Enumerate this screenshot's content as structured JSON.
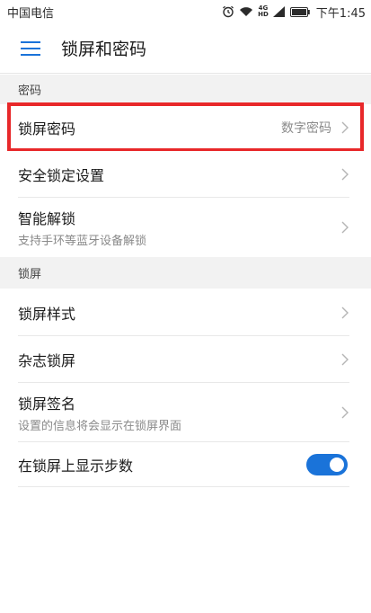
{
  "status_bar": {
    "carrier": "中国电信",
    "network_label_top": "4G",
    "network_label_bottom": "HD",
    "time": "下午1:45"
  },
  "app_bar": {
    "title": "锁屏和密码",
    "menu_icon": "hamburger-menu-icon"
  },
  "sections": {
    "password_header": "密码",
    "lock_header": "锁屏"
  },
  "rows": {
    "lock_password": {
      "title": "锁屏密码",
      "value": "数字密码"
    },
    "security_lock": {
      "title": "安全锁定设置"
    },
    "smart_unlock": {
      "title": "智能解锁",
      "subtitle": "支持手环等蓝牙设备解锁"
    },
    "lock_style": {
      "title": "锁屏样式"
    },
    "magazine_lock": {
      "title": "杂志锁屏"
    },
    "lock_signature": {
      "title": "锁屏签名",
      "subtitle": "设置的信息将会显示在锁屏界面"
    },
    "show_steps": {
      "title": "在锁屏上显示步数",
      "enabled": true
    }
  },
  "colors": {
    "accent": "#1a73d9",
    "highlight": "#e8282a",
    "section_bg": "#f2f2f2"
  }
}
